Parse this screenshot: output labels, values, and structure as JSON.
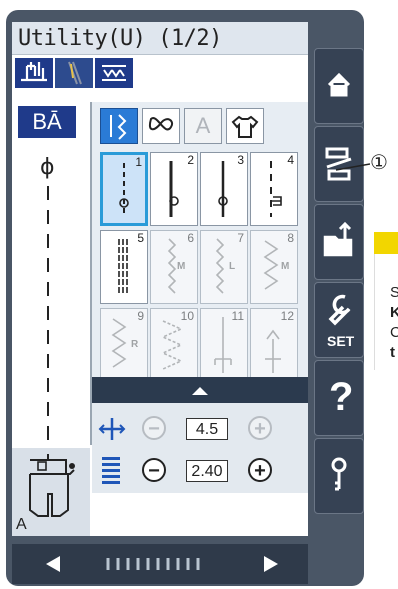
{
  "title": "Utility(U) (1/2)",
  "left_mode_label": "BĀ",
  "stitches": [
    {
      "number": "1",
      "selected": true,
      "enabled": true
    },
    {
      "number": "2",
      "selected": false,
      "enabled": true
    },
    {
      "number": "3",
      "selected": false,
      "enabled": true
    },
    {
      "number": "4",
      "selected": false,
      "enabled": true
    },
    {
      "number": "5",
      "selected": false,
      "enabled": true
    },
    {
      "number": "6",
      "mark": "M",
      "enabled": false
    },
    {
      "number": "7",
      "mark": "L",
      "enabled": false
    },
    {
      "number": "8",
      "mark": "M",
      "enabled": false
    },
    {
      "number": "9",
      "mark": "R",
      "enabled": false
    },
    {
      "number": "10",
      "enabled": false
    },
    {
      "number": "11",
      "enabled": false
    },
    {
      "number": "12",
      "enabled": false
    }
  ],
  "width_value": "4.5",
  "length_value": "2.40",
  "foot_label": "A",
  "callout_number": "①",
  "side_buttons": [
    "home-icon",
    "bobbin-winding-icon",
    "folder-upload-icon",
    "set-wrench-icon",
    "help-icon",
    "key-icon"
  ],
  "set_label": "SET",
  "help_label": "?",
  "note_letters": [
    "S",
    "K",
    "C",
    "t"
  ],
  "colors": {
    "accent": "#2a9bd8",
    "navy": "#1f3a8a",
    "panel": "#4a5666"
  }
}
